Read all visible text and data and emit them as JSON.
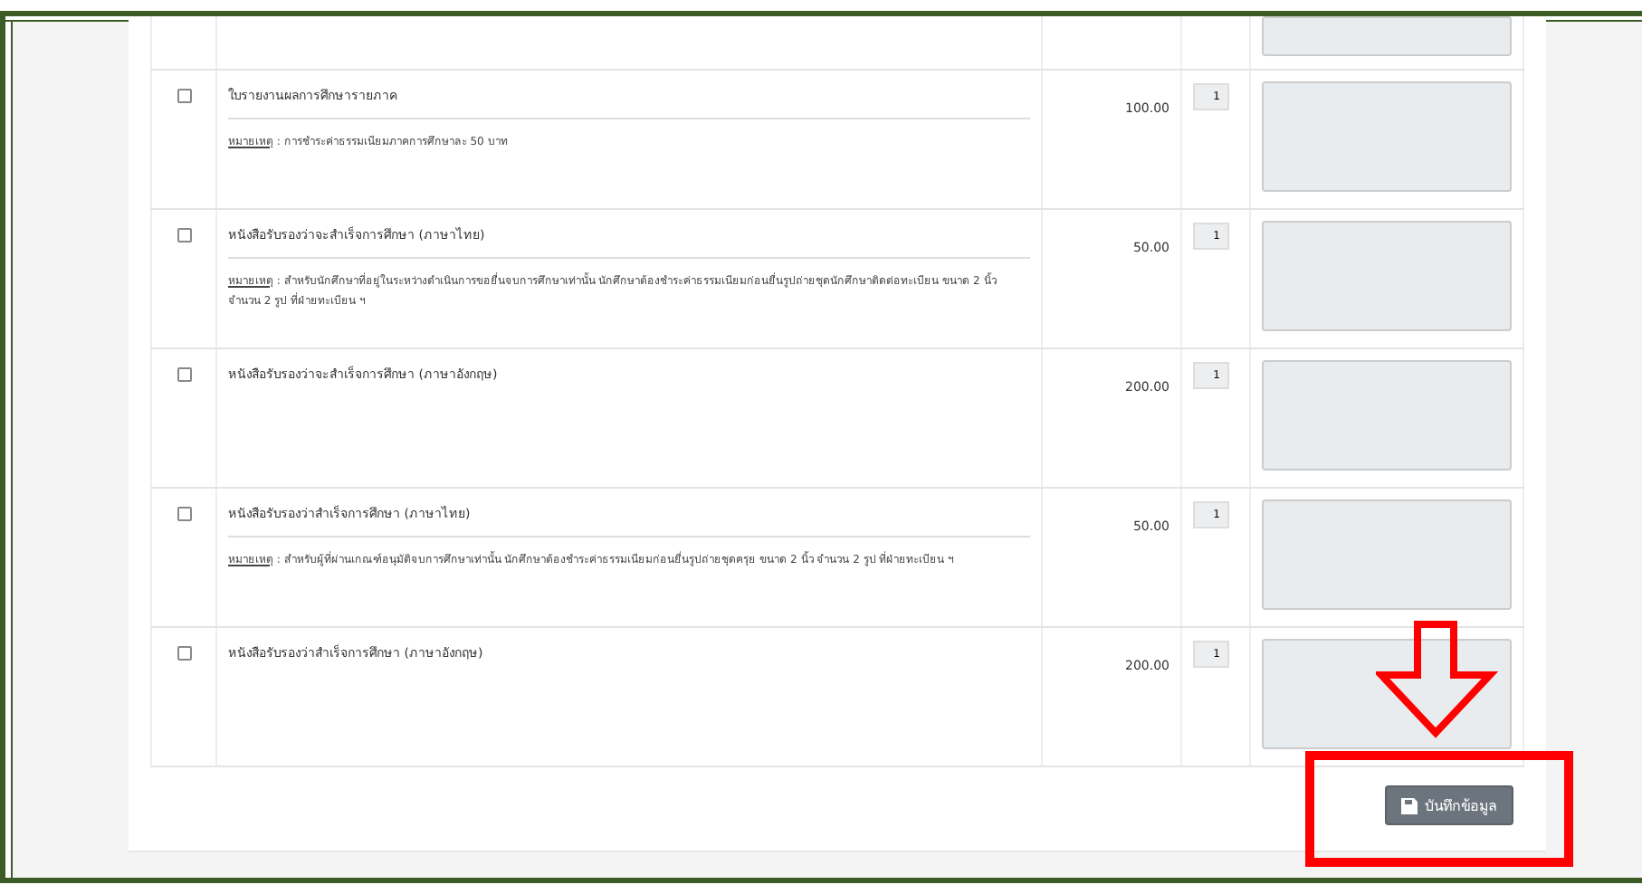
{
  "rows": [
    {
      "selected": false,
      "title": "ใบรายงานผลการศึกษารายภาค",
      "note_label": "หมายเหตุ",
      "note": ": การชำระค่าธรรมเนียมภาคการศึกษาละ 50 บาท",
      "price": "100.00",
      "quantity": "1"
    },
    {
      "selected": false,
      "title": "หนังสือรับรองว่าจะสำเร็จการศึกษา (ภาษาไทย)",
      "note_label": "หมายเหตุ",
      "note": ": สำหรับนักศึกษาที่อยู่ในระหว่างดำเนินการขอยื่นจบการศึกษาเท่านั้น นักศึกษาต้องชำระค่าธรรมเนียมก่อนยื่นรูปถ่ายชุดนักศึกษาติดต่อทะเบียน ขนาด 2 นิ้ว จำนวน 2 รูป ที่ฝ่ายทะเบียน ฯ",
      "price": "50.00",
      "quantity": "1"
    },
    {
      "selected": false,
      "title": "หนังสือรับรองว่าจะสำเร็จการศึกษา (ภาษาอังกฤษ)",
      "price": "200.00",
      "quantity": "1"
    },
    {
      "selected": false,
      "title": "หนังสือรับรองว่าสำเร็จการศึกษา (ภาษาไทย)",
      "note_label": "หมายเหตุ",
      "note": ": สำหรับผู้ที่ผ่านเกณฑ์อนุมัติจบการศึกษาเท่านั้น นักศึกษาต้องชำระค่าธรรมเนียมก่อนยื่นรูปถ่ายชุดครุย ขนาด 2 นิ้ว จำนวน 2 รูป ที่ฝ่ายทะเบียน ฯ",
      "price": "50.00",
      "quantity": "1"
    },
    {
      "selected": false,
      "title": "หนังสือรับรองว่าสำเร็จการศึกษา (ภาษาอังกฤษ)",
      "price": "200.00",
      "quantity": "1"
    }
  ],
  "save_button": {
    "label": "บันทึกข้อมูล"
  }
}
